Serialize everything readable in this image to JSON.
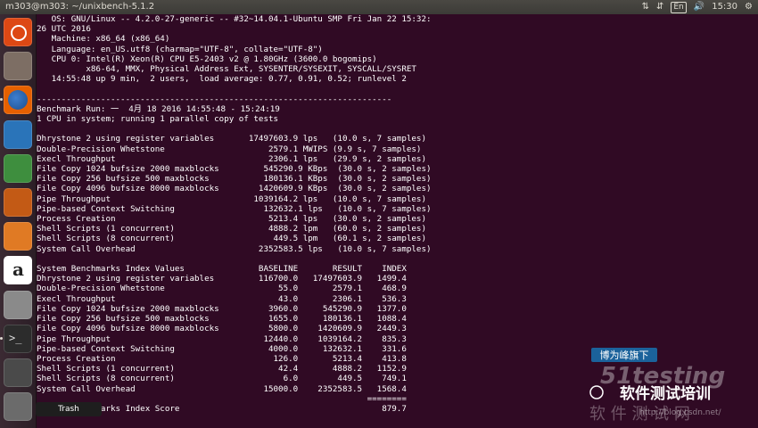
{
  "window": {
    "title": "m303@m303: ~/unixbench-5.1.2"
  },
  "tray": {
    "network_icon": "network-updown-icon",
    "sort_icon": "sort-arrows-icon",
    "keyboard": "En",
    "volume_icon": "volume-icon",
    "clock": "15:30",
    "settings_icon": "gear-icon"
  },
  "launcher": [
    {
      "name": "dash-icon",
      "color": "#dd4814"
    },
    {
      "name": "files-icon",
      "color": "#7d6e64"
    },
    {
      "name": "firefox-icon",
      "color": "#e66000"
    },
    {
      "name": "writer-icon",
      "color": "#2a74b9"
    },
    {
      "name": "calc-icon",
      "color": "#3e8e3e"
    },
    {
      "name": "impress-icon",
      "color": "#c35a15"
    },
    {
      "name": "software-center-icon",
      "color": "#e07a24"
    },
    {
      "name": "amazon-icon",
      "color": "#ffffff"
    },
    {
      "name": "system-settings-icon",
      "color": "#8a8a8a"
    },
    {
      "name": "terminal-icon",
      "color": "#2c2c2c"
    },
    {
      "name": "save-drive-icon",
      "color": "#4a4a4a"
    },
    {
      "name": "trash-icon",
      "color": "#6b6b6b"
    }
  ],
  "tooltip": "Trash",
  "terminal": {
    "lines": [
      "   OS: GNU/Linux -- 4.2.0-27-generic -- #32~14.04.1-Ubuntu SMP Fri Jan 22 15:32:",
      "26 UTC 2016",
      "   Machine: x86_64 (x86_64)",
      "   Language: en_US.utf8 (charmap=\"UTF-8\", collate=\"UTF-8\")",
      "   CPU 0: Intel(R) Xeon(R) CPU E5-2403 v2 @ 1.80GHz (3600.0 bogomips)",
      "          x86-64, MMX, Physical Address Ext, SYSENTER/SYSEXIT, SYSCALL/SYSRET",
      "   14:55:48 up 9 min,  2 users,  load average: 0.77, 0.91, 0.52; runlevel 2",
      "",
      "------------------------------------------------------------------------",
      "Benchmark Run: 一  4月 18 2016 14:55:48 - 15:24:19",
      "1 CPU in system; running 1 parallel copy of tests",
      "",
      "Dhrystone 2 using register variables       17497603.9 lps   (10.0 s, 7 samples)",
      "Double-Precision Whetstone                     2579.1 MWIPS (9.9 s, 7 samples)",
      "Execl Throughput                               2306.1 lps   (29.9 s, 2 samples)",
      "File Copy 1024 bufsize 2000 maxblocks         545290.9 KBps  (30.0 s, 2 samples)",
      "File Copy 256 bufsize 500 maxblocks           180136.1 KBps  (30.0 s, 2 samples)",
      "File Copy 4096 bufsize 8000 maxblocks        1420609.9 KBps  (30.0 s, 2 samples)",
      "Pipe Throughput                             1039164.2 lps   (10.0 s, 7 samples)",
      "Pipe-based Context Switching                  132632.1 lps   (10.0 s, 7 samples)",
      "Process Creation                               5213.4 lps   (30.0 s, 2 samples)",
      "Shell Scripts (1 concurrent)                   4888.2 lpm   (60.0 s, 2 samples)",
      "Shell Scripts (8 concurrent)                    449.5 lpm   (60.1 s, 2 samples)",
      "System Call Overhead                         2352583.5 lps   (10.0 s, 7 samples)",
      "",
      "System Benchmarks Index Values               BASELINE       RESULT    INDEX",
      "Dhrystone 2 using register variables         116700.0   17497603.9   1499.4",
      "Double-Precision Whetstone                       55.0       2579.1    468.9",
      "Execl Throughput                                 43.0       2306.1    536.3",
      "File Copy 1024 bufsize 2000 maxblocks          3960.0     545290.9   1377.0",
      "File Copy 256 bufsize 500 maxblocks            1655.0     180136.1   1088.4",
      "File Copy 4096 bufsize 8000 maxblocks          5800.0    1420609.9   2449.3",
      "Pipe Throughput                               12440.0    1039164.2    835.3",
      "Pipe-based Context Switching                   4000.0     132632.1    331.6",
      "Process Creation                                126.0       5213.4    413.8",
      "Shell Scripts (1 concurrent)                     42.4       4888.2   1152.9",
      "Shell Scripts (8 concurrent)                      6.0        449.5    749.1",
      "System Call Overhead                          15000.0    2352583.5   1568.4",
      "                                                                   ========",
      "System Benchmarks Index Score                                         879.7"
    ]
  },
  "watermark": {
    "badge": "博为峰旗下",
    "brand": "51testing",
    "slogan": "软件测试培训",
    "subtitle": "软 件 测 试 网",
    "url": "http://blog.csdn.net/"
  }
}
